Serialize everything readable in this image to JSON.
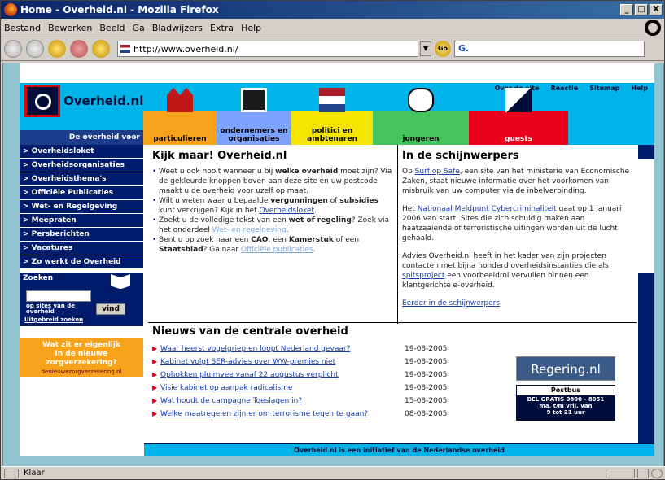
{
  "window": {
    "title": "Home - Overheid.nl - Mozilla Firefox",
    "btn_min": "_",
    "btn_max": "□",
    "btn_close": "X"
  },
  "menu": [
    "Bestand",
    "Bewerken",
    "Beeld",
    "Ga",
    "Bladwijzers",
    "Extra",
    "Help"
  ],
  "address": {
    "url": "http://www.overheid.nl/",
    "go_label": "Go",
    "search_label": "G."
  },
  "status": {
    "text": "Klaar"
  },
  "site": {
    "logo": "Overheid.nl",
    "tagline": "De overheid voor",
    "top_links": [
      "Over de site",
      "Reactie",
      "Sitemap",
      "Help"
    ],
    "categories": [
      {
        "label": "particulieren",
        "color": "#f7a21b"
      },
      {
        "label": "ondernemers en organisaties",
        "color": "#7ea2ff"
      },
      {
        "label": "politici en ambtenaren",
        "color": "#f6e500"
      },
      {
        "label": "jongeren",
        "color": "#45c35c"
      },
      {
        "label": "guests",
        "color": "#e8001d"
      }
    ],
    "nav": [
      "> Overheidsloket",
      "> Overheidsorganisaties",
      "> Overheidsthema's",
      "> Officiële Publicaties",
      "> Wet- en Regelgeving",
      "> Meepraten",
      "> Persberichten",
      "> Vacatures",
      "> Zo werkt de Overheid"
    ],
    "search": {
      "title": "Zoeken",
      "sub": "op sites van de overheid",
      "button": "vind",
      "advanced": "Uitgebreid zoeken"
    },
    "promo": {
      "line1": "Wat zit er eigenlijk",
      "line2": "in de nieuwe",
      "line3": "zorgverzekering?",
      "url": "denieuwezorgverzekering.nl"
    },
    "main": {
      "title": "Kijk maar! Overheid.nl",
      "b1": {
        "t1": "Weet u ook nooit wanneer u bij ",
        "b": "welke overheid",
        "t2": " moet zijn? Via de gekleurde knoppen boven aan deze site en uw postcode maakt u de overheid voor uzelf op maat."
      },
      "b2": {
        "t1": "Wilt u weten waar u bepaalde ",
        "b1": "vergunningen",
        "t2": " of ",
        "b2": "subsidies",
        "t3": " kunt verkrijgen? Kijk in het ",
        "link": "Overheidsloket",
        "t4": "."
      },
      "b3": {
        "t1": "Zoekt u de volledige tekst van een ",
        "b": "wet of regeling",
        "t2": "? Zoek via het onderdeel ",
        "link": "Wet- en regelgeving",
        "t3": "."
      },
      "b4": {
        "t1": "Bent u op zoek naar een ",
        "b1": "CAO",
        "t2": ", een ",
        "b2": "Kamerstuk",
        "t3": " of een ",
        "b3": "Staatsblad",
        "t4": "? Ga naar ",
        "link": "Officiële publicaties",
        "t5": "."
      }
    },
    "side": {
      "title": "In de schijnwerpers",
      "p1": {
        "t1": "Op ",
        "link": "Surf op Safe",
        "t2": ", een site van het ministerie van Economische Zaken, staat nieuwe informatie over het voorkomen van misbruik van uw computer via de inbelverbinding."
      },
      "p2": {
        "t1": "Het ",
        "link": "Nationaal Meldpunt Cybercriminaliteit",
        "t2": " gaat op 1 januari 2006 van start. Sites die zich schuldig maken aan haatzaaiende of terroristische uitingen worden uit de lucht gehaald."
      },
      "p3": {
        "t1": "Advies Overheid.nl heeft in het kader van zijn projecten contacten met bijna honderd overheidsinstanties die als ",
        "link": "spitsproject",
        "t2": " een voorbeeldrol vervullen binnen een klantgerichte e-overheid."
      },
      "more": "Eerder in de schijnwerpers"
    },
    "news": {
      "title": "Nieuws van de centrale overheid",
      "items": [
        {
          "title": "Waar heerst vogelgriep en loopt Nederland gevaar?",
          "date": "19-08-2005"
        },
        {
          "title": "Kabinet volgt SER-advies over WW-premies niet",
          "date": "19-08-2005"
        },
        {
          "title": "Ophokken pluimvee vanaf 22 augustus verplicht",
          "date": "19-08-2005"
        },
        {
          "title": "Visie kabinet op aanpak radicalisme",
          "date": "19-08-2005"
        },
        {
          "title": "Wat houdt de campagne Toeslagen in?",
          "date": "15-08-2005"
        },
        {
          "title": "Welke maatregelen zijn er om terrorisme tegen te gaan?",
          "date": "08-08-2005"
        }
      ]
    },
    "regering": "Regering.nl",
    "postbus": {
      "head": "Postbus",
      "l1": "BEL GRATIS 0800 - 8051",
      "l2": "ma. t/m vrij. van",
      "l3": "9 tot 21 uur"
    },
    "footer": "Overheid.nl is een initiatief van de Nederlandse overheid"
  }
}
